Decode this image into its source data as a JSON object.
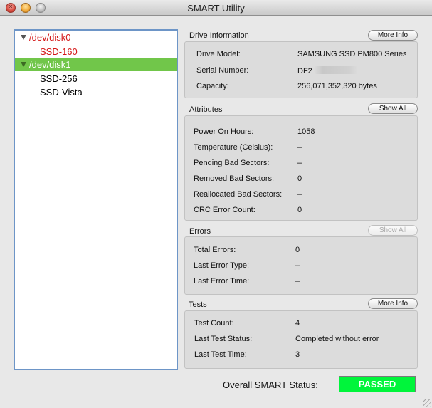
{
  "window": {
    "title": "SMART Utility"
  },
  "sidebar": {
    "items": [
      {
        "label": "/dev/disk0",
        "level": 0,
        "expanded": true,
        "state": "error"
      },
      {
        "label": "SSD-160",
        "level": 1,
        "state": "error"
      },
      {
        "label": "/dev/disk1",
        "level": 0,
        "expanded": true,
        "state": "selected"
      },
      {
        "label": "SSD-256",
        "level": 1,
        "state": "normal"
      },
      {
        "label": "SSD-Vista",
        "level": 1,
        "state": "normal"
      }
    ]
  },
  "drive_info": {
    "title": "Drive Information",
    "button": "More Info",
    "rows": [
      {
        "label": "Drive Model:",
        "value": "SAMSUNG SSD PM800 Series"
      },
      {
        "label": "Serial Number:",
        "value": "DF2"
      },
      {
        "label": "Capacity:",
        "value": "256,071,352,320 bytes"
      }
    ]
  },
  "attributes": {
    "title": "Attributes",
    "button": "Show All",
    "rows": [
      {
        "label": "Power On Hours:",
        "value": "1058"
      },
      {
        "label": "Temperature (Celsius):",
        "value": "–"
      },
      {
        "label": "Pending Bad Sectors:",
        "value": "–"
      },
      {
        "label": "Removed Bad Sectors:",
        "value": "0"
      },
      {
        "label": "Reallocated Bad Sectors:",
        "value": "–"
      },
      {
        "label": "CRC Error Count:",
        "value": "0"
      }
    ]
  },
  "errors": {
    "title": "Errors",
    "button": "Show All",
    "button_enabled": false,
    "rows": [
      {
        "label": "Total Errors:",
        "value": "0"
      },
      {
        "label": "Last Error Type:",
        "value": "–"
      },
      {
        "label": "Last Error Time:",
        "value": "–"
      }
    ]
  },
  "tests": {
    "title": "Tests",
    "button": "More Info",
    "rows": [
      {
        "label": "Test Count:",
        "value": "4"
      },
      {
        "label": "Last Test Status:",
        "value": "Completed without error"
      },
      {
        "label": "Last Test Time:",
        "value": "3"
      }
    ]
  },
  "status": {
    "label": "Overall SMART Status:",
    "value": "PASSED",
    "color": "#00f53b"
  },
  "colors": {
    "selection": "#71c64a",
    "error_text": "#d41616",
    "focus_border": "#6d95c7"
  }
}
